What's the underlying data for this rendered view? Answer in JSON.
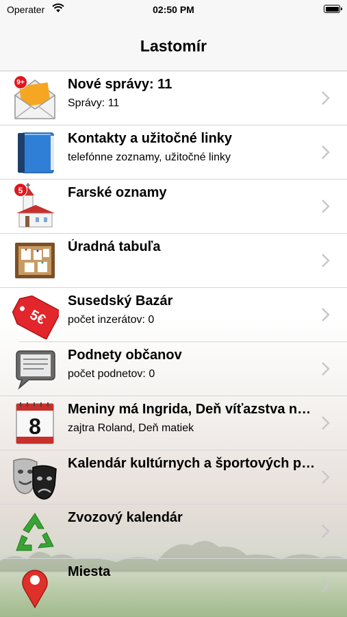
{
  "status_bar": {
    "carrier": "Operater",
    "time": "02:50 PM"
  },
  "nav": {
    "title": "Lastomír"
  },
  "items": [
    {
      "title": "Nové správy: 11",
      "subtitle": "Správy: 11",
      "badge": "9+",
      "icon": "mail-envelope-icon"
    },
    {
      "title": "Kontakty a užitočné linky",
      "subtitle": "telefónne zoznamy, užitočné linky",
      "icon": "address-book-icon"
    },
    {
      "title": "Farské oznamy",
      "subtitle": "",
      "badge": "5",
      "icon": "church-icon"
    },
    {
      "title": "Úradná tabuľa",
      "subtitle": "",
      "icon": "bulletin-board-icon"
    },
    {
      "title": "Susedský Bazár",
      "subtitle": "počet inzerátov: 0",
      "tag": "5€",
      "icon": "price-tag-icon"
    },
    {
      "title": "Podnety občanov",
      "subtitle": "počet podnetov: 0",
      "icon": "speech-bubble-icon"
    },
    {
      "title": "Meniny má Ingrida, Deň víťazstva nad fašizmom",
      "subtitle": "zajtra Roland, Deň matiek",
      "calendar_day": "8",
      "icon": "calendar-icon"
    },
    {
      "title": "Kalendár kultúrnych a športových podujatí",
      "subtitle": "",
      "icon": "theater-masks-icon"
    },
    {
      "title": "Zvozový kalendár",
      "subtitle": "",
      "icon": "recycle-icon"
    },
    {
      "title": "Miesta",
      "subtitle": "",
      "icon": "map-pin-icon"
    }
  ],
  "colors": {
    "badge": "#e0171f",
    "separator": "#d5d5d8",
    "chevron": "#c7c7cc"
  }
}
